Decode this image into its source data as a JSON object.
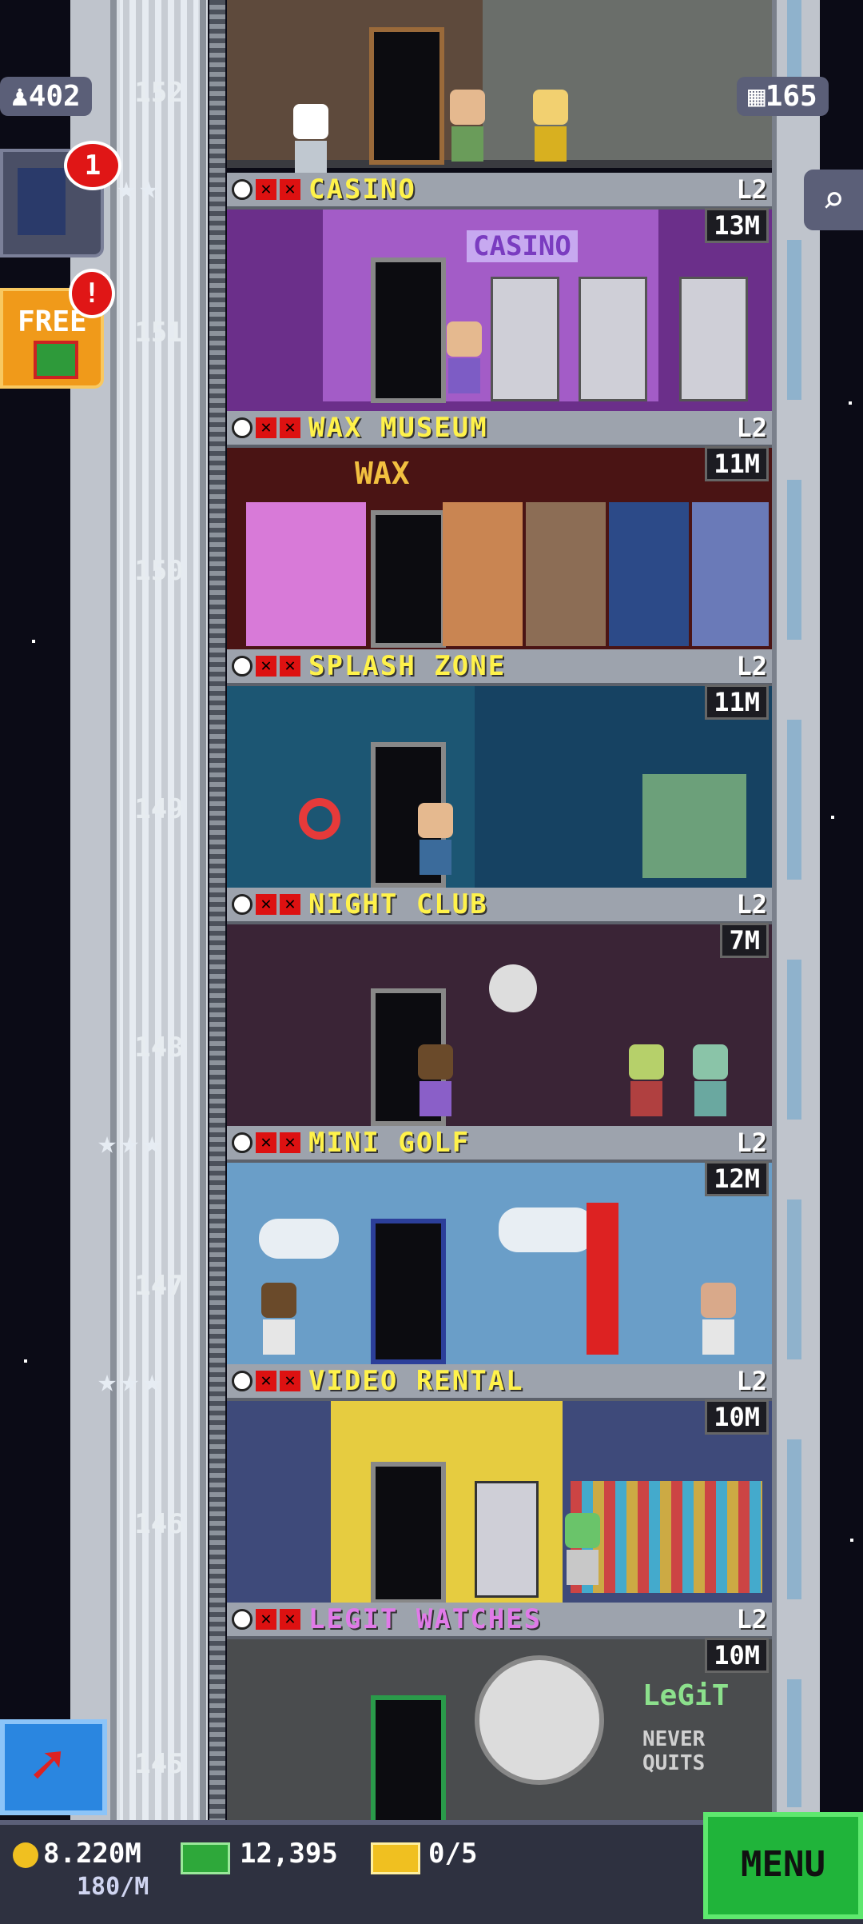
{
  "hud": {
    "population": "402",
    "floors": "165"
  },
  "side_buttons": {
    "hero_badge": "1",
    "free_label": "FREE",
    "free_badge": "!"
  },
  "floor_numbers": [
    "152",
    "151",
    "150",
    "149",
    "148",
    "147",
    "146",
    "145"
  ],
  "floors": [
    {
      "name": "CASINO",
      "level": "L2",
      "income": "13M",
      "sign": "CASINO",
      "name_color": "#fff24a"
    },
    {
      "name": "WAX MUSEUM",
      "level": "L2",
      "income": "11M",
      "sign": "WAX",
      "name_color": "#fff24a"
    },
    {
      "name": "SPLASH ZONE",
      "level": "L2",
      "income": "11M",
      "sign": "",
      "name_color": "#fff24a"
    },
    {
      "name": "NIGHT CLUB",
      "level": "L2",
      "income": "7M",
      "sign": "",
      "name_color": "#fff24a"
    },
    {
      "name": "MINI GOLF",
      "level": "L2",
      "income": "12M",
      "sign": "",
      "name_color": "#fff24a"
    },
    {
      "name": "VIDEO RENTAL",
      "level": "L2",
      "income": "10M",
      "sign": "",
      "name_color": "#fff24a"
    },
    {
      "name": "LEGIT WATCHES",
      "level": "L2",
      "income": "10M",
      "sign": "LeGiT",
      "sign2": "NEVER QUITS",
      "name_color": "#e07ae8"
    }
  ],
  "footer": {
    "coins": "8.220M",
    "coins_rate": "180/M",
    "bux": "12,395",
    "tickets": "0/5",
    "menu_label": "MENU"
  },
  "colors": {
    "star_icon": "#e6ecf3",
    "accent_green": "#20b43a",
    "name_yellow": "#fff24a"
  },
  "icons": [
    "person-icon",
    "building-icon",
    "search-icon",
    "clock-icon",
    "x-icon",
    "coin-icon",
    "bux-icon",
    "ticket-icon",
    "arrow-icon",
    "gift-icon",
    "hero-avatar-icon"
  ]
}
